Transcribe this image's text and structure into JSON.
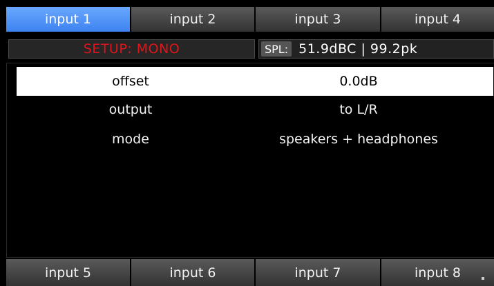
{
  "top_tabs": [
    {
      "label": "input 1",
      "active": true
    },
    {
      "label": "input 2",
      "active": false
    },
    {
      "label": "input 3",
      "active": false
    },
    {
      "label": "input 4",
      "active": false
    }
  ],
  "status": {
    "setup": "SETUP: MONO",
    "spl_label": "SPL:",
    "spl_value": "51.9dBC | 99.2pk"
  },
  "settings": [
    {
      "label": "offset",
      "value": "0.0dB",
      "selected": true
    },
    {
      "label": "output",
      "value": "to L/R",
      "selected": false
    },
    {
      "label": "mode",
      "value": "speakers + headphones",
      "selected": false
    }
  ],
  "bottom_tabs": [
    {
      "label": "input 5"
    },
    {
      "label": "input 6"
    },
    {
      "label": "input 7"
    },
    {
      "label": "input 8"
    }
  ],
  "colors": {
    "accent": "#3d82f0",
    "setup_text": "#e0141a",
    "background": "#000000"
  }
}
